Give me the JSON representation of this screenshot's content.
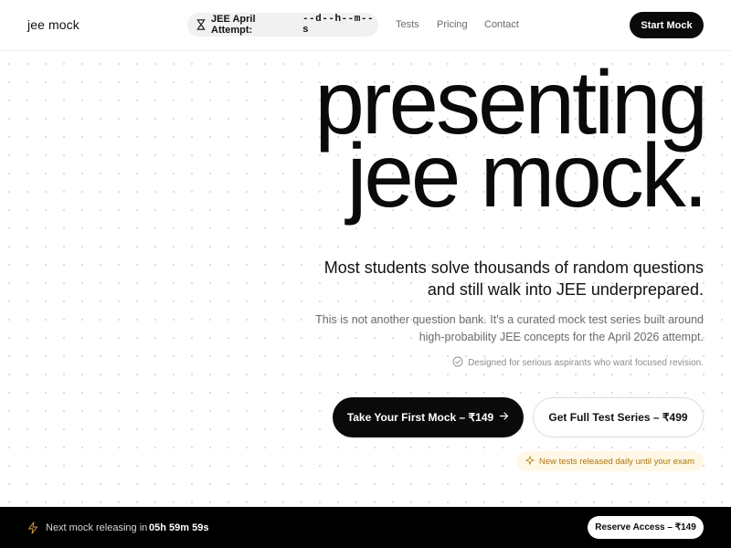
{
  "header": {
    "brand": "jee mock",
    "countdown": {
      "label": "JEE April Attempt:",
      "value": "--d--h--m--s",
      "icon": "hourglass-icon"
    },
    "nav": [
      {
        "label": "Tests"
      },
      {
        "label": "Pricing"
      },
      {
        "label": "Contact"
      }
    ],
    "cta_label": "Start Mock"
  },
  "hero": {
    "title_line1": "presenting",
    "title_line2": "jee mock.",
    "subhead": "Most students solve thousands of random questions and still walk into JEE underprepared.",
    "description": "This is not another question bank. It's a curated mock test series built around high-probability JEE concepts for the April 2026 attempt.",
    "designed_note": "Designed for serious aspirants who want focused revision.",
    "primary_cta": "Take Your First Mock – ₹149",
    "secondary_cta": "Get Full Test Series – ₹499",
    "daily_badge": "New tests released daily until your exam"
  },
  "bottom_bar": {
    "label": "Next mock releasing in",
    "time": "05h 59m 59s",
    "button": "Reserve Access – ₹149"
  },
  "colors": {
    "primary": "#0a0a0a",
    "background": "#ffffff",
    "accent_amber": "#b07510",
    "badge_bg": "#fff8e6"
  }
}
